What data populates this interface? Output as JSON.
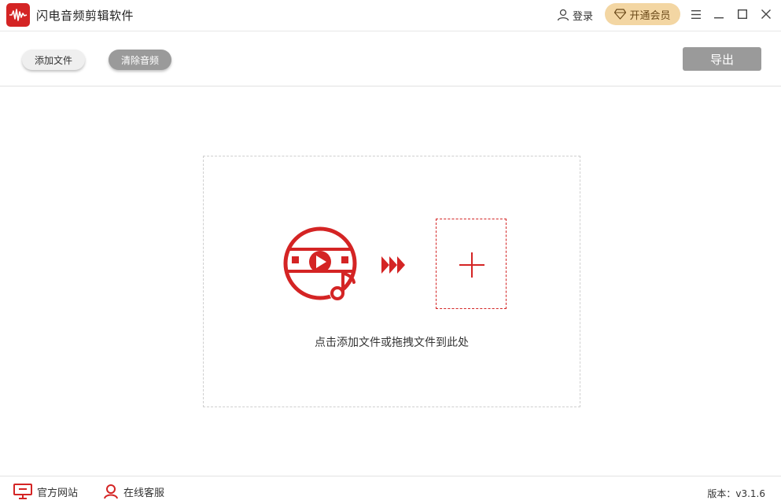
{
  "app": {
    "title": "闪电音频剪辑软件",
    "accent_color": "#d42424"
  },
  "header": {
    "login_label": "登录",
    "vip_label": "开通会员",
    "vip_color": "#f3d6a3"
  },
  "toolbar": {
    "add_file_label": "添加文件",
    "clear_audio_label": "清除音频",
    "export_label": "导出"
  },
  "dropzone": {
    "hint": "点击添加文件或拖拽文件到此处"
  },
  "footer": {
    "website_label": "官方网站",
    "support_label": "在线客服",
    "version": "版本：v3.1.6"
  },
  "icons": [
    "app-logo-icon",
    "user-icon",
    "diamond-icon",
    "menu-icon",
    "minimize-icon",
    "maximize-icon",
    "close-icon",
    "media-file-icon",
    "forward-arrows-icon",
    "plus-icon",
    "monitor-icon",
    "support-agent-icon"
  ]
}
